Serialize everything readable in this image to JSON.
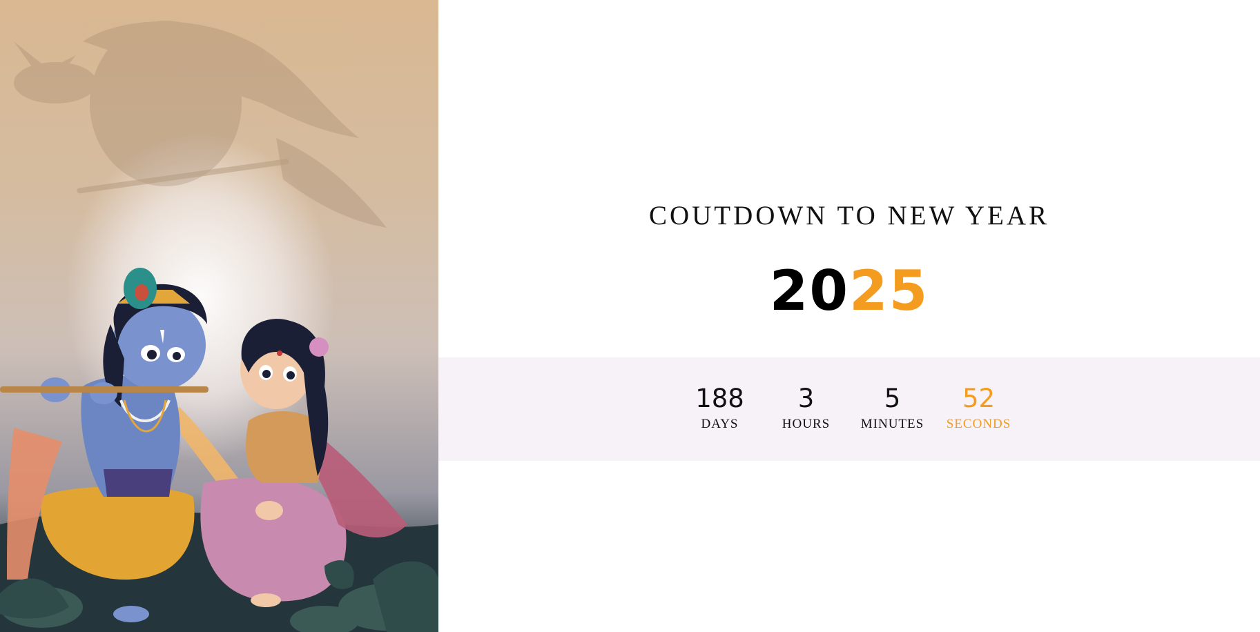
{
  "hero": {
    "image_alt": "Illustration of Krishna playing the flute beside Radha",
    "colors": {
      "sky_top": "#d9b892",
      "glow": "#ffffff",
      "ground": "#22343a"
    }
  },
  "countdown": {
    "heading": "COUTDOWN TO NEW YEAR",
    "year_part_a": "20",
    "year_part_b": "25",
    "units": [
      {
        "value": "188",
        "label": "DAYS"
      },
      {
        "value": "3",
        "label": "HOURS"
      },
      {
        "value": "5",
        "label": "MINUTES"
      },
      {
        "value": "52",
        "label": "SECONDS"
      }
    ],
    "accent_color": "#f39c1f",
    "band_color": "#f7f1f8"
  }
}
